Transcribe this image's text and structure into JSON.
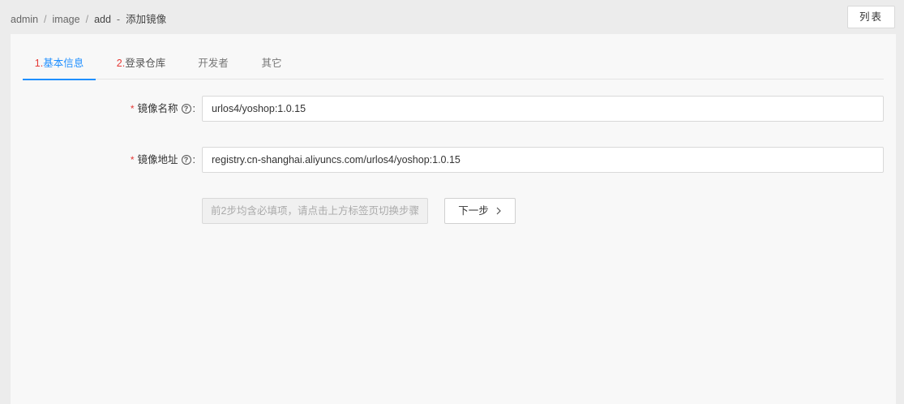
{
  "breadcrumb": {
    "items": [
      "admin",
      "image",
      "add"
    ],
    "separator": "/",
    "page_title": "添加镜像"
  },
  "header": {
    "list_button_label": "列表"
  },
  "tabs": [
    {
      "number": "1.",
      "label": "基本信息",
      "active": true
    },
    {
      "number": "2.",
      "label": "登录仓库",
      "active": false
    },
    {
      "number": "",
      "label": "开发者",
      "active": false
    },
    {
      "number": "",
      "label": "其它",
      "active": false
    }
  ],
  "form": {
    "image_name": {
      "required_mark": "*",
      "label": "镜像名称",
      "help_icon": "question-circle-icon",
      "value": "urlos4/yoshop:1.0.15"
    },
    "image_address": {
      "required_mark": "*",
      "label": "镜像地址",
      "help_icon": "question-circle-icon",
      "value": "registry.cn-shanghai.aliyuncs.com/urlos4/yoshop:1.0.15"
    }
  },
  "actions": {
    "disabled_hint_label": "前2步均含必填项，请点击上方标签页切换步骤",
    "next_label": "下一步",
    "next_icon": "chevron-right-icon"
  },
  "colors": {
    "accent": "#1f8fff",
    "required": "#e53935"
  }
}
